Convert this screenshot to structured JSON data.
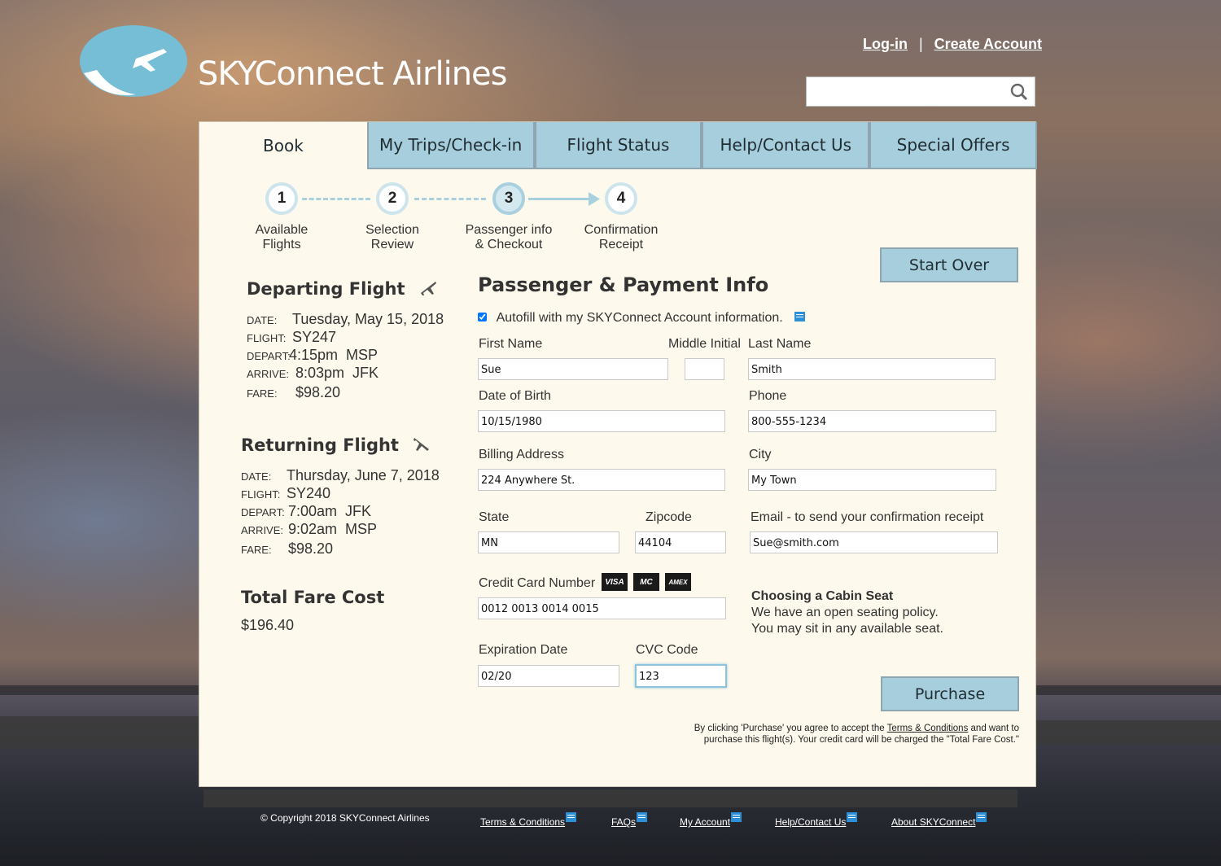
{
  "header": {
    "brand": "SKYConnect Airlines",
    "login": "Log-in",
    "separator": "|",
    "create_account": "Create Account",
    "search_value": ""
  },
  "tabs": [
    {
      "label": "Book",
      "active": true
    },
    {
      "label": "My Trips/Check-in"
    },
    {
      "label": "Flight Status"
    },
    {
      "label": "Help/Contact Us"
    },
    {
      "label": "Special Offers"
    }
  ],
  "steps": [
    {
      "num": "1",
      "line1": "Available",
      "line2": "Flights"
    },
    {
      "num": "2",
      "line1": "Selection",
      "line2": "Review"
    },
    {
      "num": "3",
      "line1": "Passenger info",
      "line2": "& Checkout"
    },
    {
      "num": "4",
      "line1": "Confirmation",
      "line2": "Receipt"
    }
  ],
  "start_over": "Start Over",
  "departing": {
    "title": "Departing Flight",
    "date_k": "DATE:",
    "date": "Tuesday, May 15, 2018",
    "flight_k": "FLIGHT:",
    "flight": "SY247",
    "depart_k": "DEPART:",
    "depart": "4:15pm  MSP",
    "arrive_k": "ARRIVE:",
    "arrive": "8:03pm  JFK",
    "fare_k": "FARE:",
    "fare": "$98.20"
  },
  "returning": {
    "title": "Returning Flight",
    "date_k": "DATE:",
    "date": "Thursday, June 7, 2018",
    "flight_k": "FLIGHT:",
    "flight": "SY240",
    "depart_k": "DEPART:",
    "depart": "7:00am  JFK",
    "arrive_k": "ARRIVE:",
    "arrive": "9:02am  MSP",
    "fare_k": "FARE:",
    "fare": "$98.20"
  },
  "total": {
    "title": "Total Fare Cost",
    "value": "$196.40"
  },
  "form": {
    "title": "Passenger & Payment Info",
    "autofill": "Autofill with my SKYConnect Account information.",
    "first_name_label": "First Name",
    "first_name": "Sue",
    "middle_label": "Middle Initial",
    "middle": "",
    "last_name_label": "Last Name",
    "last_name": "Smith",
    "dob_label": "Date of Birth",
    "dob": "10/15/1980",
    "phone_label": "Phone",
    "phone": "800-555-1234",
    "address_label": "Billing Address",
    "address": "224 Anywhere St.",
    "city_label": "City",
    "city": "My Town",
    "state_label": "State",
    "state": "MN",
    "zip_label": "Zipcode",
    "zip": "44104",
    "email_label": "Email - to send your confirmation receipt",
    "email": "Sue@smith.com",
    "cc_label": "Credit Card Number",
    "cc": "0012 0013 0014 0015",
    "exp_label": "Expiration Date",
    "exp": "02/20",
    "cvc_label": "CVC Code",
    "cvc": "123"
  },
  "cards": {
    "visa": "VISA",
    "mastercard": "MC",
    "amex": "AMEX"
  },
  "cabin": {
    "title": "Choosing a Cabin Seat",
    "line1": "We have an open seating policy.",
    "line2": "You may sit in any available seat."
  },
  "purchase": "Purchase",
  "terms": {
    "pre": "By clicking 'Purchase' you agree to accept the ",
    "link": "Terms & Conditions",
    "post": " and want to",
    "line2": "purchase this flight(s). Your credit card will be charged the \"Total Fare Cost.\""
  },
  "footer": {
    "copyright": "© Copyright 2018 SKYConnect Airlines",
    "links": [
      "Terms & Conditions",
      "FAQs",
      "My Account",
      "Help/Contact Us",
      "About SKYConnect"
    ]
  },
  "colors": {
    "accent": "#a7cedc",
    "panel": "#fdf9ec",
    "link_icon": "#2d8fd6"
  }
}
